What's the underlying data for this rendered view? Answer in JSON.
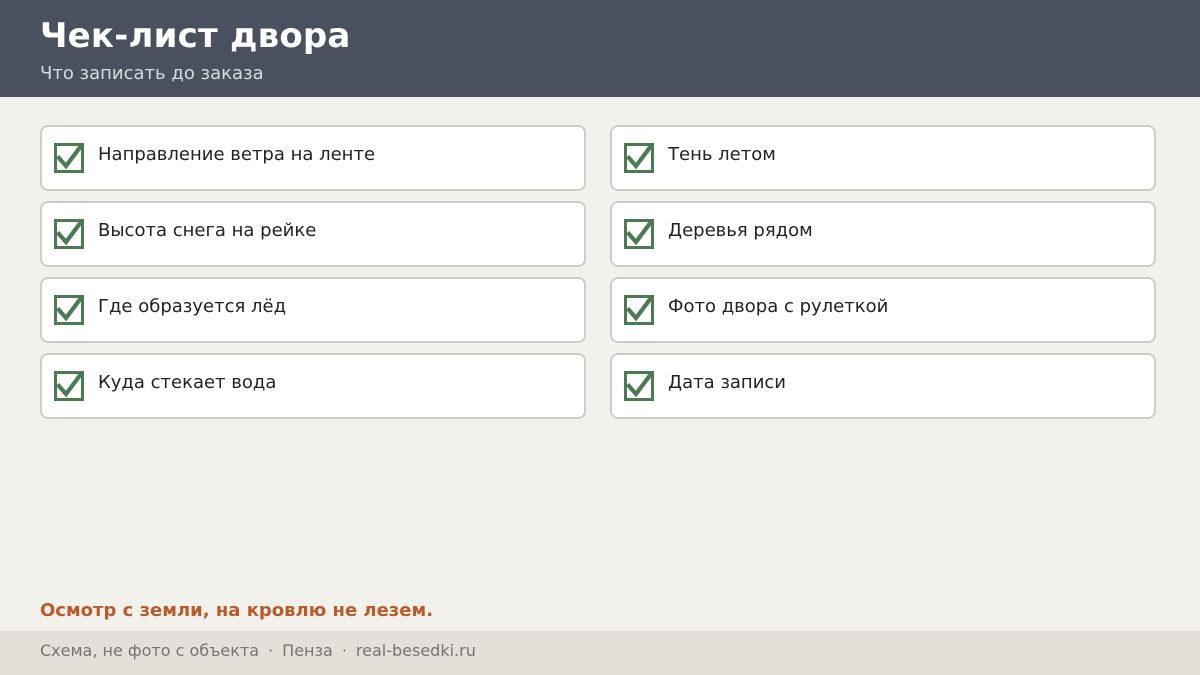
{
  "header": {
    "title": "Чек-лист двора",
    "subtitle": "Что записать до заказа"
  },
  "checklist": {
    "items": [
      {
        "label": "Направление ветра на ленте",
        "checked": true
      },
      {
        "label": "Тень летом",
        "checked": true
      },
      {
        "label": "Высота снега на рейке",
        "checked": true
      },
      {
        "label": "Деревья рядом",
        "checked": true
      },
      {
        "label": "Где образуется лёд",
        "checked": true
      },
      {
        "label": "Фото двора с рулеткой",
        "checked": true
      },
      {
        "label": "Куда стекает вода",
        "checked": true
      },
      {
        "label": "Дата записи",
        "checked": true
      }
    ]
  },
  "warning": "Осмотр с земли, на кровлю не лезем.",
  "footer": {
    "note": "Схема, не фото с объекта",
    "separator": "·",
    "city": "Пенза",
    "site": "real-besedki.ru"
  },
  "colors": {
    "header_bg": "#48515d",
    "check_green": "#4d7a55",
    "warning": "#b95b2a",
    "page_bg": "#f3f1ec"
  },
  "icons": {
    "check": "checkbox-checked-icon"
  }
}
